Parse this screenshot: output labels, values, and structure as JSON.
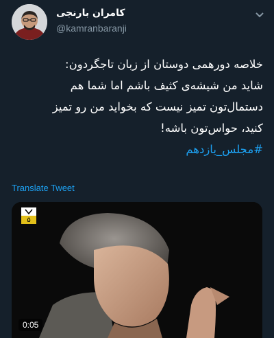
{
  "user": {
    "display_name": "کامران بارنجی",
    "handle": "@kamranbaranji"
  },
  "tweet": {
    "lines": [
      "خلاصه دورهمی دوستان از زبان تاجگردون:",
      "شاید من شیشه‌ی کثیف باشم اما شما هم",
      "دستمال‌تون تمیز نیست که بخواید من رو تمیز",
      "کنید، حواس‌تون باشه!"
    ],
    "hashtag": "#مجلس_یازدهم"
  },
  "translate_label": "Translate Tweet",
  "media": {
    "timestamp": "0:05",
    "logo_text": "۵"
  },
  "colors": {
    "background": "#15202b",
    "accent": "#1da1f2",
    "muted": "#8899a6"
  },
  "icons": {
    "menu": "chevron-down-icon",
    "channel": "tv-logo-icon"
  }
}
